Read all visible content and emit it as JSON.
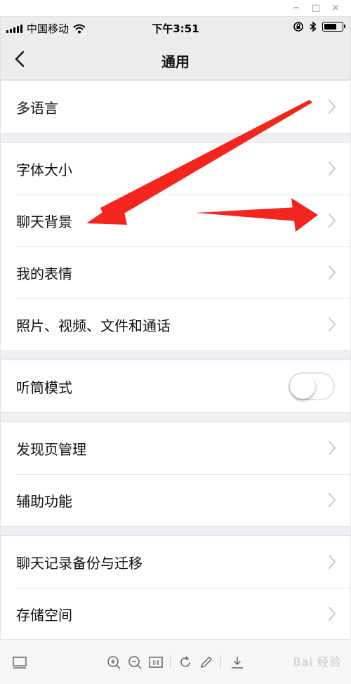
{
  "status_bar": {
    "carrier": "中国移动",
    "time": "下午3:51",
    "battery_level": 0.75
  },
  "nav": {
    "title": "通用"
  },
  "groups": [
    {
      "items": [
        {
          "label": "多语言",
          "type": "chevron"
        }
      ]
    },
    {
      "items": [
        {
          "label": "字体大小",
          "type": "chevron"
        },
        {
          "label": "聊天背景",
          "type": "chevron"
        },
        {
          "label": "我的表情",
          "type": "chevron"
        },
        {
          "label": "照片、视频、文件和通话",
          "type": "chevron"
        }
      ]
    },
    {
      "items": [
        {
          "label": "听筒模式",
          "type": "toggle",
          "on": false
        }
      ]
    },
    {
      "items": [
        {
          "label": "发现页管理",
          "type": "chevron"
        },
        {
          "label": "辅助功能",
          "type": "chevron"
        }
      ]
    },
    {
      "items": [
        {
          "label": "聊天记录备份与迁移",
          "type": "chevron"
        },
        {
          "label": "存储空间",
          "type": "chevron"
        }
      ]
    }
  ],
  "annotation": {
    "arrow_color": "#f2251f"
  },
  "toolbar": {
    "watermark": "Bai 经验",
    "buttons": [
      "thumbnail-icon",
      "zoom-in-icon",
      "zoom-out-icon",
      "actual-size-icon",
      "rotate-icon",
      "edit-icon",
      "download-icon"
    ]
  },
  "colors": {
    "background": "#efeff4",
    "nav_bar": "#ececec",
    "separator": "#e6e6e6",
    "chevron": "#c7c7cc"
  }
}
